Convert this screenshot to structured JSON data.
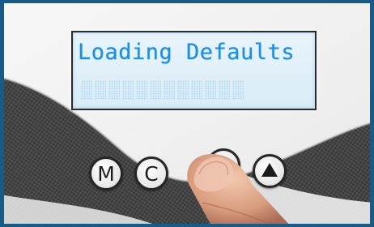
{
  "display": {
    "line1": "Loading Defaults",
    "line2_cells": 12
  },
  "buttons": {
    "menu_label": "M",
    "cancel_label": "C",
    "blank_label": "",
    "up_icon": "triangle-up-icon"
  },
  "colors": {
    "panel": "#f2f2f2",
    "lcd_background": "#e3f1fa",
    "lcd_text": "#1f8ee0",
    "frame": "#1a5b86",
    "button_border": "#262626"
  }
}
